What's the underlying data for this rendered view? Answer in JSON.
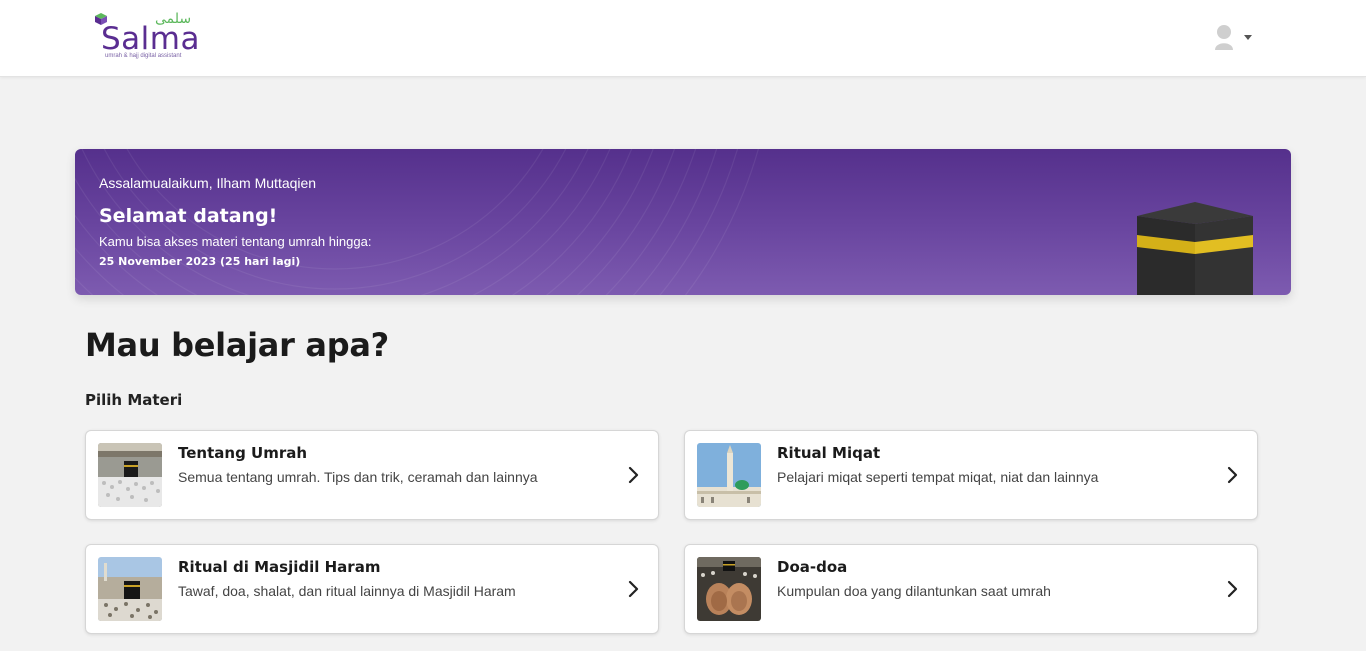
{
  "header": {
    "logo_text": "Salma",
    "logo_arabic": "سلمى",
    "logo_tagline": "umrah & hajj digital assistant",
    "avatar_icon": "user-avatar-icon",
    "menu_icon": "caret-down-icon"
  },
  "banner": {
    "greeting": "Assalamualaikum, Ilham Muttaqien",
    "welcome": "Selamat datang!",
    "access_text": "Kamu bisa akses materi tentang umrah hingga:",
    "expiry": "25 November 2023 (25 hari lagi)",
    "background_color": "#5f3a96",
    "illustration_icon": "kaaba-icon"
  },
  "main": {
    "heading": "Mau belajar apa?",
    "subheading": "Pilih Materi"
  },
  "cards": [
    {
      "title": "Tentang Umrah",
      "description": "Semua tentang umrah. Tips dan trik, ceramah dan lainnya",
      "image": "kaaba-crowd-photo",
      "chevron": "chevron-right-icon"
    },
    {
      "title": "Ritual Miqat",
      "description": "Pelajari miqat seperti tempat miqat, niat dan lainnya",
      "image": "mosque-minaret-photo",
      "chevron": "chevron-right-icon"
    },
    {
      "title": "Ritual di Masjidil Haram",
      "description": "Tawaf, doa, shalat, dan ritual lainnya di Masjidil Haram",
      "image": "masjidil-haram-photo",
      "chevron": "chevron-right-icon"
    },
    {
      "title": "Doa-doa",
      "description": "Kumpulan doa yang dilantunkan saat umrah",
      "image": "praying-hands-photo",
      "chevron": "chevron-right-icon"
    }
  ]
}
